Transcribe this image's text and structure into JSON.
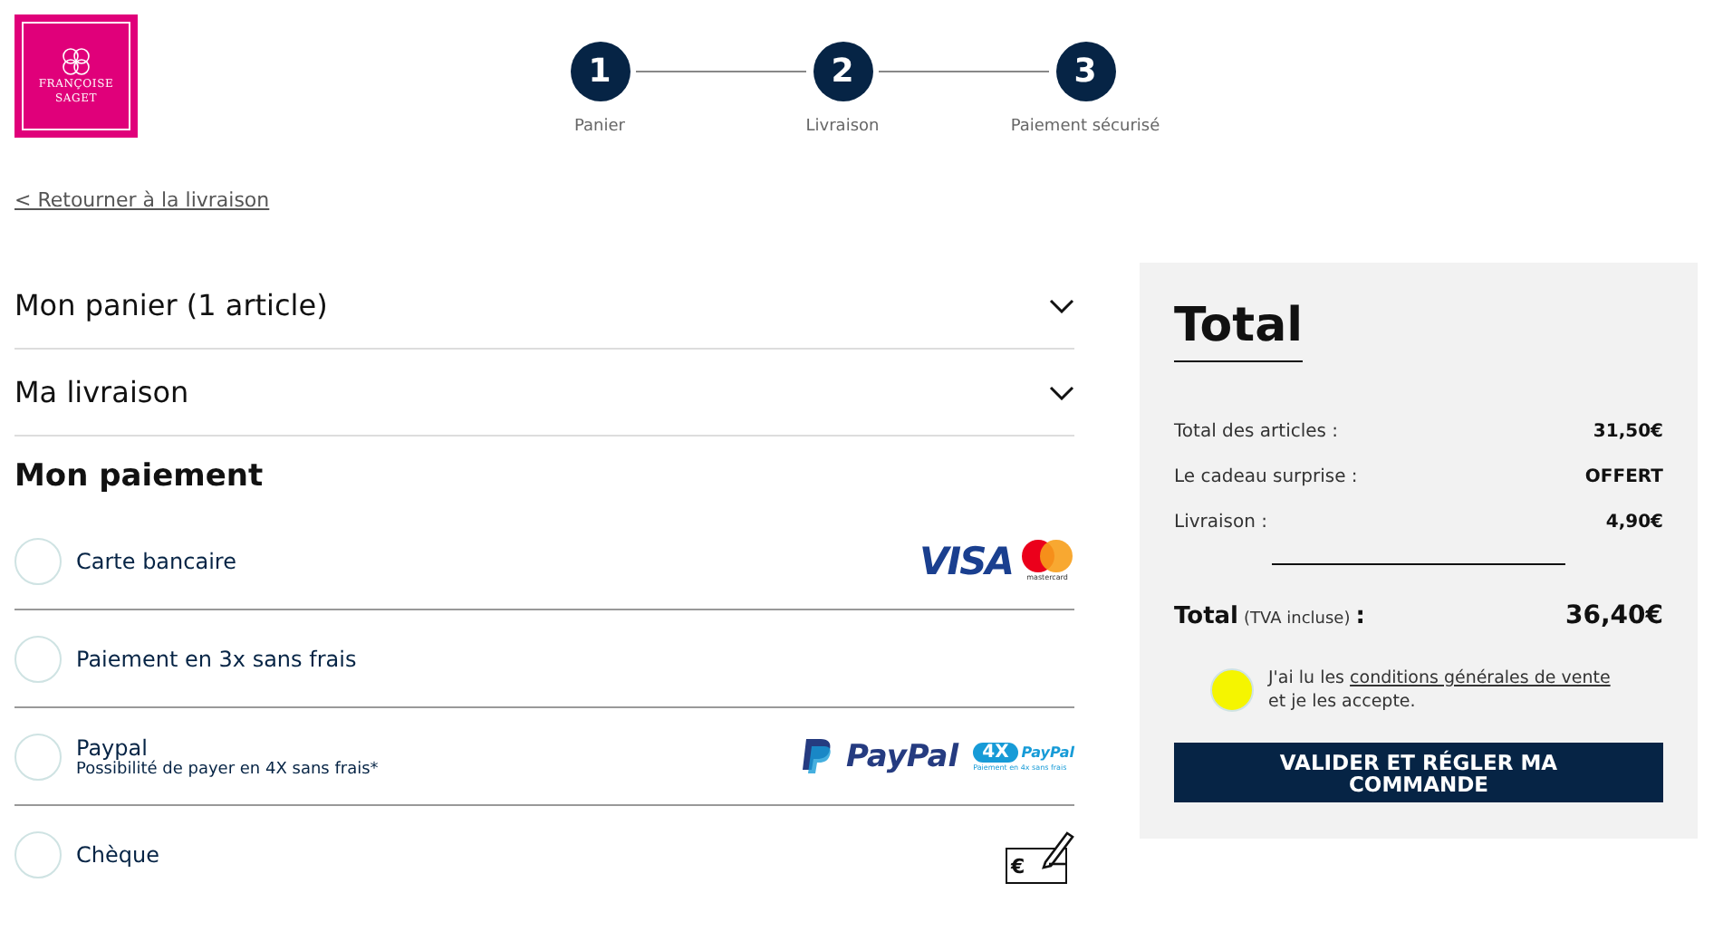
{
  "logo": {
    "lines": [
      "FRANÇOISE",
      "SAGET"
    ]
  },
  "steps": [
    {
      "number": "1",
      "label": "Panier"
    },
    {
      "number": "2",
      "label": "Livraison"
    },
    {
      "number": "3",
      "label": "Paiement sécurisé"
    }
  ],
  "back_link": "< Retourner à la livraison",
  "sections": [
    {
      "title": "Mon panier (1 article)",
      "expanded": false
    },
    {
      "title": "Ma livraison",
      "expanded": false
    }
  ],
  "payment": {
    "title": "Mon paiement",
    "methods": [
      {
        "label": "Carte bancaire",
        "selected": false,
        "logo": {
          "kind": "cards",
          "text": "VISA",
          "small": "mastercard"
        }
      },
      {
        "label": "Paiement en 3x sans frais",
        "selected": false
      },
      {
        "label": "Paypal",
        "sublabel": "Possibilité de payer en 4X sans frais*",
        "selected": false,
        "logo": {
          "kind": "paypal",
          "text": "PayPal",
          "badge": "4X",
          "badge_brand": "PayPal",
          "small": "Paiement en 4x sans frais"
        }
      },
      {
        "label": "Chèque",
        "selected": false,
        "logo": {
          "kind": "cheque",
          "text": "€"
        }
      }
    ]
  },
  "summary": {
    "title": "Total",
    "lines": [
      {
        "label": "Total des articles :",
        "value": "31,50€"
      },
      {
        "label": "Le cadeau surprise :",
        "value": "OFFERT"
      },
      {
        "label": "Livraison :",
        "value": "4,90€"
      }
    ],
    "total_label": "Total",
    "total_note": "(TVA incluse)",
    "total_colon": ":",
    "total_value": "36,40€",
    "terms": {
      "checked": false,
      "highlighted": true,
      "before": "J'ai lu les",
      "link": "conditions générales de vente",
      "after": "et je les accepte."
    },
    "button": "VALIDER ET RÉGLER MA COMMANDE"
  }
}
